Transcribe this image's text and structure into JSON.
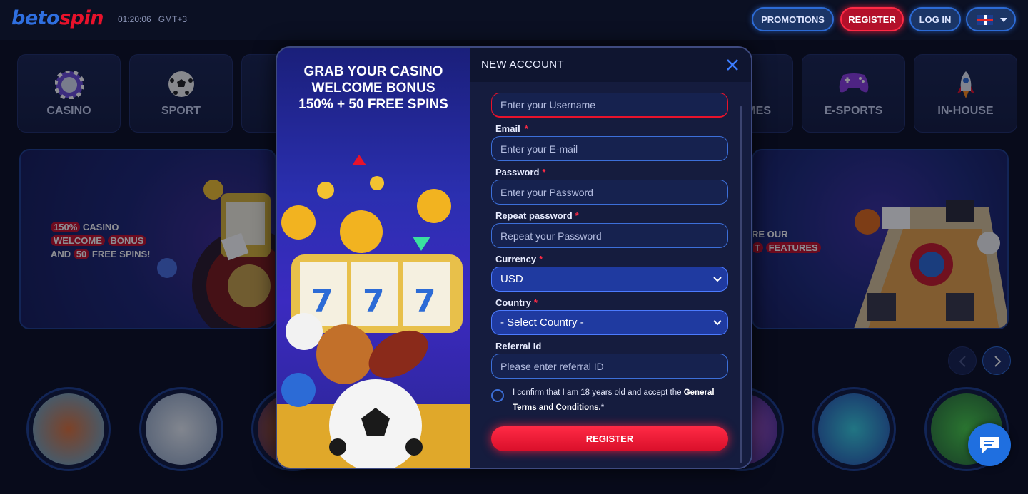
{
  "brand": {
    "part1": "beto",
    "part2": "spin"
  },
  "clock": {
    "time": "01:20:06",
    "tz": "GMT+3"
  },
  "header": {
    "promotions": "PROMOTIONS",
    "register": "REGISTER",
    "login": "LOG IN"
  },
  "categories": [
    {
      "label": "CASINO",
      "icon": "poker-chip-icon"
    },
    {
      "label": "SPORT",
      "icon": "soccer-ball-icon"
    },
    {
      "label": "MES",
      "icon": "game-icon"
    },
    {
      "label": "E-SPORTS",
      "icon": "gamepad-icon"
    },
    {
      "label": "IN-HOUSE",
      "icon": "rocket-icon"
    }
  ],
  "banner_left": {
    "line1_a": "150%",
    "line1_b": "CASINO",
    "line2_a": "WELCOME",
    "line2_b": "BONUS",
    "line3_a": "AND",
    "line3_b": "50",
    "line3_c": "FREE SPINS!"
  },
  "banner_right": {
    "line1": "RE OUR",
    "line2_a": "T",
    "line2_b": "FEATURES"
  },
  "modal": {
    "headline1": "GRAB YOUR CASINO",
    "headline2": "WELCOME BONUS",
    "headline3": "150% + 50 FREE SPINS",
    "title": "NEW ACCOUNT",
    "username_placeholder": "Enter your Username",
    "email_label": "Email",
    "email_placeholder": "Enter your E-mail",
    "password_label": "Password",
    "password_placeholder": "Enter your Password",
    "repeat_label": "Repeat password",
    "repeat_placeholder": "Repeat your Password",
    "currency_label": "Currency",
    "currency_value": "USD",
    "country_label": "Country",
    "country_value": "- Select Country -",
    "referral_label": "Referral Id",
    "referral_placeholder": "Please enter referral ID",
    "required_mark": "*",
    "terms_text": "I confirm that I am 18 years old and accept the ",
    "terms_link": "General Terms and Conditions.",
    "terms_star": "*",
    "register_button": "REGISTER"
  },
  "colors": {
    "accent_blue": "#2c6bd6",
    "accent_red": "#ff2a45",
    "bg": "#0b1023"
  }
}
